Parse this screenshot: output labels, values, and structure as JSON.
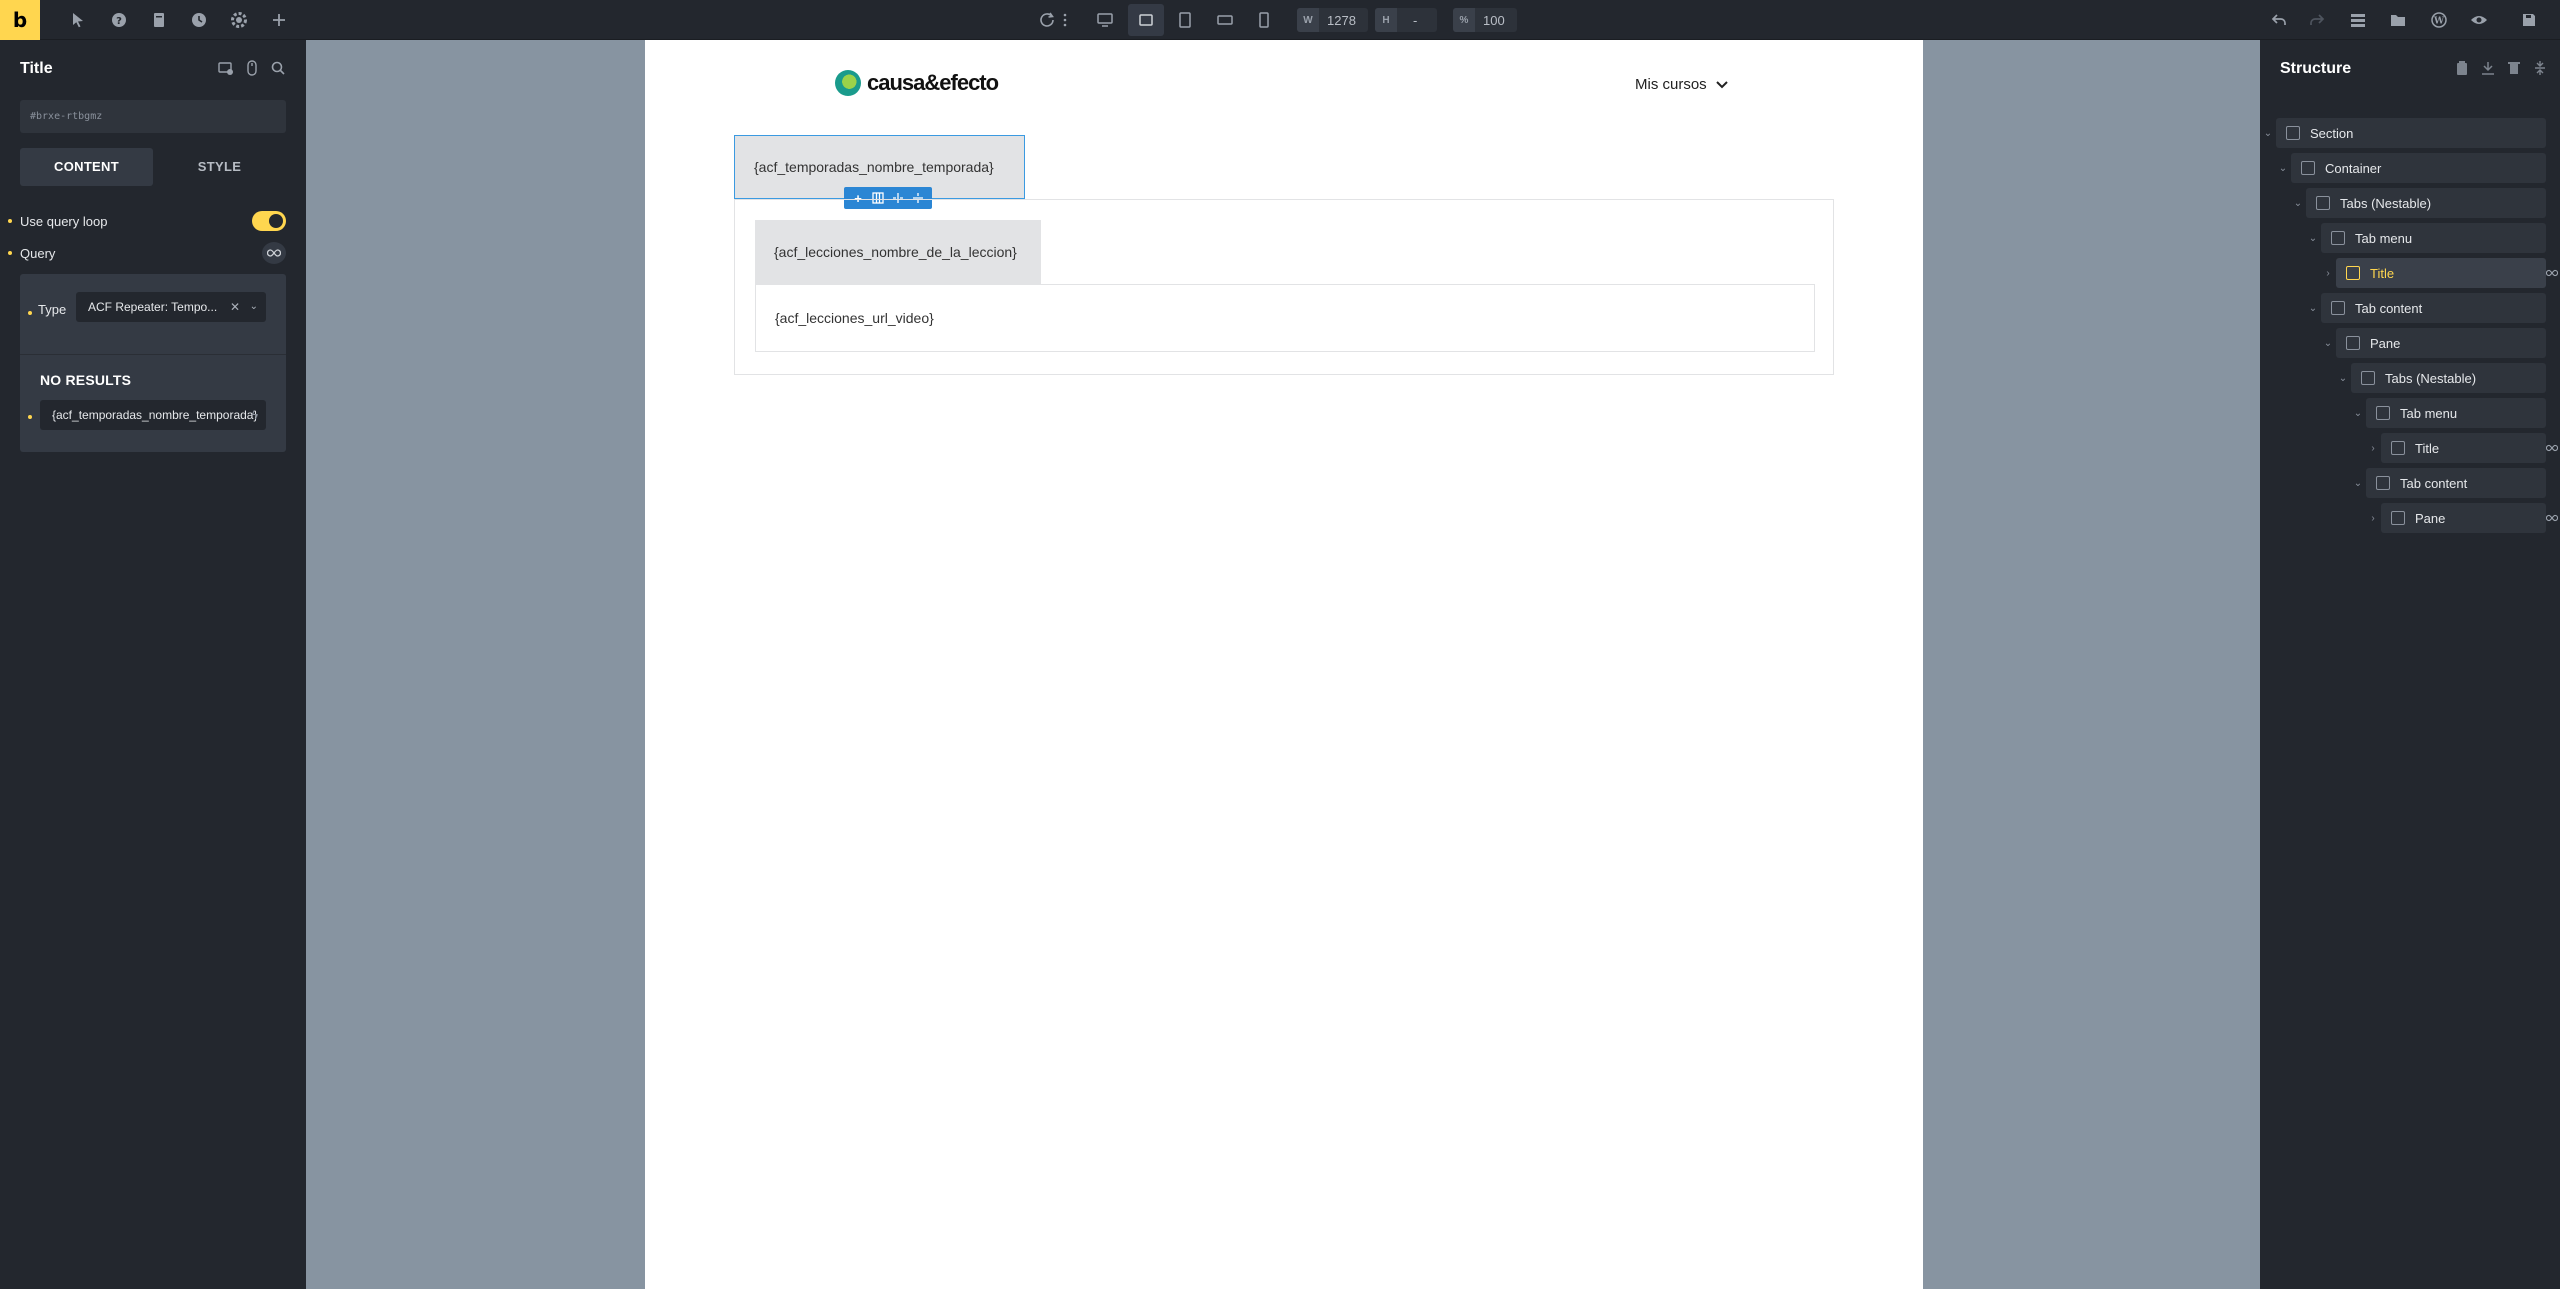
{
  "topbar": {
    "logo": "b",
    "width_label": "W",
    "width_value": "1278",
    "height_label": "H",
    "height_value": "-",
    "zoom_label": "%",
    "zoom_value": "100"
  },
  "left_panel": {
    "title": "Title",
    "element_id": "#brxe-rtbgmz",
    "tabs": [
      "CONTENT",
      "STYLE"
    ],
    "use_query_loop": "Use query loop",
    "query": "Query",
    "popup": {
      "type_label": "Type",
      "type_value": "ACF Repeater: Tempo...",
      "no_results": "NO RESULTS",
      "dynamic_value": "{acf_temporadas_nombre_temporada}"
    }
  },
  "page": {
    "brand": "causa&efecto",
    "menu": "Mis cursos",
    "tab_title": "{acf_temporadas_nombre_temporada}",
    "inner_title": "{acf_lecciones_nombre_de_la_leccion}",
    "inner_pane": "{acf_lecciones_url_video}"
  },
  "structure": {
    "title": "Structure",
    "items": [
      {
        "label": "Section"
      },
      {
        "label": "Container"
      },
      {
        "label": "Tabs (Nestable)"
      },
      {
        "label": "Tab menu"
      },
      {
        "label": "Title"
      },
      {
        "label": "Tab content"
      },
      {
        "label": "Pane"
      },
      {
        "label": "Tabs (Nestable)"
      },
      {
        "label": "Tab menu"
      },
      {
        "label": "Title"
      },
      {
        "label": "Tab content"
      },
      {
        "label": "Pane"
      }
    ]
  },
  "colors": {
    "accent": "#ffd64f",
    "panel": "#23272e",
    "canvas": "#8794a1",
    "selection": "#2b86d4"
  }
}
